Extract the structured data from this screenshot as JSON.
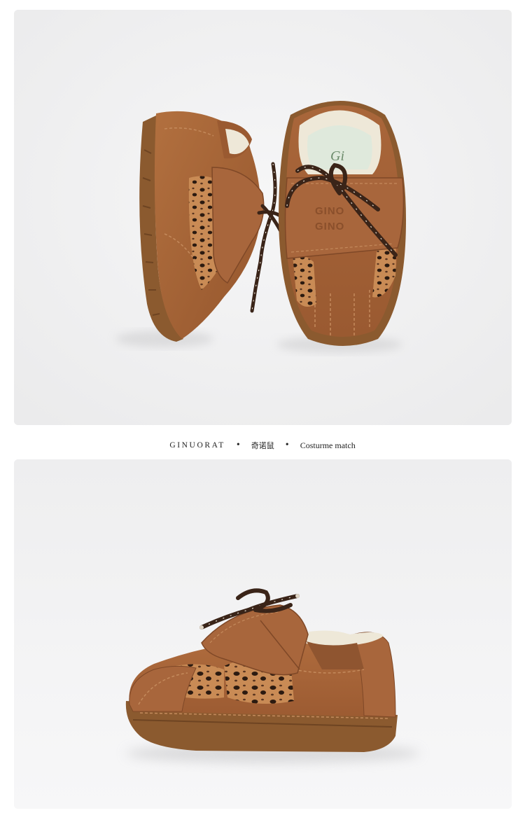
{
  "caption": {
    "brand": "GINUORAT",
    "separator": "•",
    "chinese_name": "奇诺鼠",
    "tagline": "Costurme match"
  },
  "embossed_logo": {
    "line1": "GINO",
    "line2": "GINO",
    "insole_text": "Gi"
  },
  "photos": [
    {
      "subject": "pair-of-toddler-shoes-top-view"
    },
    {
      "subject": "single-toddler-shoe-side-view"
    }
  ],
  "colors": {
    "backdrop": "#f1f1f2",
    "suede": "#a8663c",
    "suede_dark": "#8a4f2b",
    "sole": "#8b5a2f",
    "leopard_base": "#c98b55",
    "leopard_spot": "#2b1a10",
    "lace": "#3a2418",
    "lining": "#eee8d8",
    "insole": "#dfe9dc"
  }
}
